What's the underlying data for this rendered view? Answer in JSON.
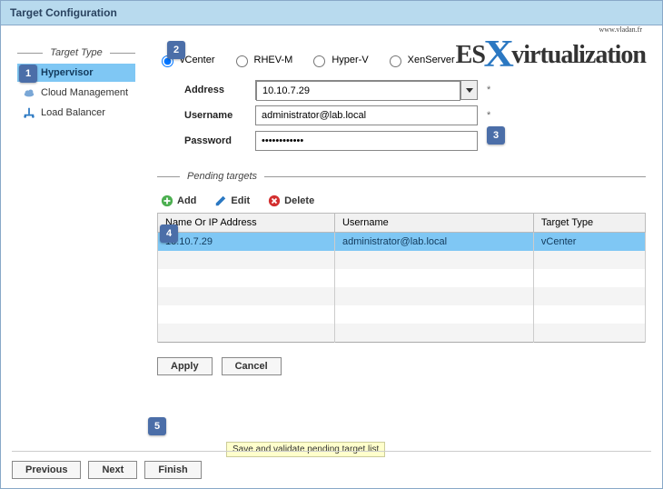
{
  "title": "Target Configuration",
  "brand": {
    "prefix": "ES",
    "suffix": "virtualization",
    "url": "www.vladan.fr"
  },
  "callouts": [
    "1",
    "2",
    "3",
    "4",
    "5"
  ],
  "sidebar": {
    "heading": "Target Type",
    "items": [
      {
        "label": "Hypervisor",
        "active": true
      },
      {
        "label": "Cloud Management",
        "active": false
      },
      {
        "label": "Load Balancer",
        "active": false
      }
    ]
  },
  "radios": {
    "options": [
      {
        "label": "vCenter",
        "checked": true
      },
      {
        "label": "RHEV-M",
        "checked": false
      },
      {
        "label": "Hyper-V",
        "checked": false
      },
      {
        "label": "XenServer",
        "checked": false
      }
    ]
  },
  "form": {
    "address_label": "Address",
    "address_value": "10.10.7.29",
    "username_label": "Username",
    "username_value": "administrator@lab.local",
    "password_label": "Password",
    "password_value": "************"
  },
  "pending": {
    "heading": "Pending targets",
    "actions": {
      "add": "Add",
      "edit": "Edit",
      "delete": "Delete"
    },
    "columns": [
      "Name Or IP Address",
      "Username",
      "Target Type"
    ],
    "rows": [
      {
        "address": "10.10.7.29",
        "username": "administrator@lab.local",
        "type": "vCenter",
        "selected": true
      }
    ],
    "empty_rows": 5
  },
  "buttons": {
    "apply": "Apply",
    "cancel": "Cancel",
    "previous": "Previous",
    "next": "Next",
    "finish": "Finish"
  },
  "tooltip": "Save and validate pending target list"
}
